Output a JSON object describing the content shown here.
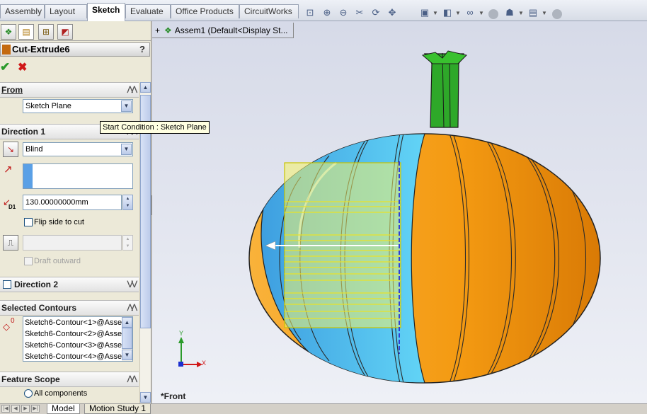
{
  "command_tabs": [
    "Assembly",
    "Layout",
    "Sketch",
    "Evaluate",
    "Office Products",
    "CircuitWorks"
  ],
  "active_command_tab": "Sketch",
  "view_toolbar_icons": [
    "zoom-to-fit-icon",
    "zoom-to-area-icon",
    "previous-view-icon",
    "section-view-icon",
    "rotate-icon",
    "pan-icon",
    "view-orientation-icon",
    "display-style-icon",
    "hide-show-items-icon",
    "edit-appearance-icon",
    "apply-scene-icon",
    "view-settings-icon"
  ],
  "panel_tabs": [
    "featuremanager-tab-icon",
    "propertymanager-tab-icon",
    "configurationmanager-tab-icon",
    "displaymanager-tab-icon"
  ],
  "feature": {
    "title": "Cut-Extrude6",
    "help": "?",
    "ok_icon": "✔",
    "cancel_icon": "✖"
  },
  "from": {
    "header": "From",
    "value": "Sketch Plane"
  },
  "tooltip": "Start Condition : Sketch Plane",
  "direction1": {
    "header": "Direction 1",
    "end_condition": "Blind",
    "depth": "130.00000000mm",
    "depth_icon_label": "D1",
    "flip_label": "Flip side to cut",
    "draft_outward_label": "Draft outward"
  },
  "direction2": {
    "header": "Direction 2"
  },
  "selected_contours": {
    "header": "Selected Contours",
    "icon_label": "0",
    "items": [
      "Sketch6-Contour<1>@Asse",
      "Sketch6-Contour<2>@Asse",
      "Sketch6-Contour<3>@Asse",
      "Sketch6-Contour<4>@Asse"
    ]
  },
  "feature_scope": {
    "header": "Feature Scope",
    "option_all": "All components"
  },
  "tree_flyout": {
    "expand": "+",
    "label": "Assem1  (Default<Display St..."
  },
  "view_label": "*Front",
  "triad": {
    "x": "X",
    "y": "Y"
  },
  "bottom_tabs": [
    "Model",
    "Motion Study 1"
  ],
  "active_bottom_tab": "Model",
  "colors": {
    "pumpkin_orange": "#f5a21a",
    "pumpkin_blue": "#5ab8ee",
    "stem_green": "#2da22a",
    "preview_yellow": "#f4f26a",
    "viewport_bg": "#e2e5ef"
  }
}
